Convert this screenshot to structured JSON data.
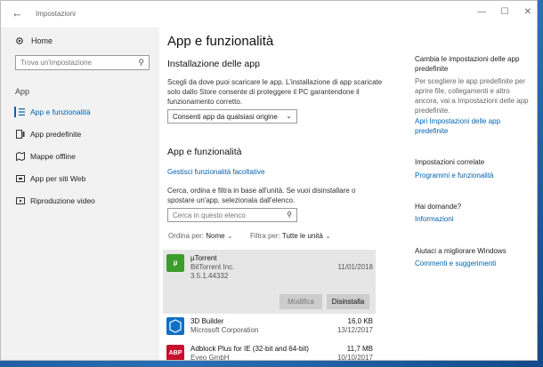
{
  "window": {
    "title": "Impostazioni",
    "controls": {
      "minimize": "—",
      "maximize": "☐",
      "close": "✕"
    },
    "back": "←"
  },
  "sidebar": {
    "home_label": "Home",
    "search_placeholder": "Trova un'impostazione",
    "section_label": "App",
    "items": [
      {
        "label": "App e funzionalità",
        "icon": "list-icon",
        "active": true
      },
      {
        "label": "App predefinite",
        "icon": "default-apps-icon",
        "active": false
      },
      {
        "label": "Mappe offline",
        "icon": "map-icon",
        "active": false
      },
      {
        "label": "App per siti Web",
        "icon": "websites-icon",
        "active": false
      },
      {
        "label": "Riproduzione video",
        "icon": "video-icon",
        "active": false
      }
    ]
  },
  "main": {
    "title": "App e funzionalità",
    "install_heading": "Installazione delle app",
    "install_desc_1": "Scegli da dove puoi scaricare le app. L'installazione di app scaricate",
    "install_desc_2": "solo dallo Store consente di proteggere il PC garantendone il",
    "install_desc_3": "funzionamento corretto.",
    "install_dropdown": "Consenti app da qualsiasi origine",
    "apps_heading": "App e funzionalità",
    "manage_link": "Gestisci funzionalità facoltative",
    "search_desc_1": "Cerca, ordina e filtra in base all'unità. Se vuoi disinstallare o",
    "search_desc_2": "spostare un'app, selezionala dall'elenco.",
    "list_search_placeholder": "Cerca in questo elenco",
    "sort_label": "Ordina per:",
    "sort_value": "Nome",
    "filter_label": "Filtra per:",
    "filter_value": "Tutte le unità",
    "modify_button": "Modifica",
    "uninstall_button": "Disinstalla",
    "apps": [
      {
        "name": "µTorrent",
        "publisher": "BitTorrent Inc.",
        "version": "3.5.1.44332",
        "size": "",
        "date": "11/01/2018",
        "icon_color": "#3b9e2a",
        "icon_text": "µ"
      },
      {
        "name": "3D Builder",
        "publisher": "Microsoft Corporation",
        "version": "",
        "size": "16,0 KB",
        "date": "13/12/2017",
        "icon_color": "#0f6fc6",
        "icon_text": ""
      },
      {
        "name": "Adblock Plus for IE (32-bit and 64-bit)",
        "publisher": "Eyeo GmbH",
        "version": "",
        "size": "11,7 MB",
        "date": "10/10/2017",
        "icon_color": "#c8102e",
        "icon_text": "ABP"
      }
    ]
  },
  "right": {
    "related_heading": "Cambia le impostazioni delle app predefinite",
    "related_desc": "Per scegliere le app predefinite per aprire file, collegamenti e altro ancora, vai a Impostazioni delle app predefinite.",
    "related_link": "Apri Impostazioni delle app predefinite",
    "settings_heading": "Impostazioni correlate",
    "settings_link": "Programmi e funzionalità",
    "help_heading": "Hai domande?",
    "help_link": "Informazioni",
    "improve_heading": "Aiutaci a migliorare Windows",
    "improve_link": "Commenti e suggerimenti"
  },
  "colors": {
    "accent": "#0063b1",
    "sidebar_bg": "#f2f2f2",
    "selected_bg": "#e6e6e6"
  }
}
